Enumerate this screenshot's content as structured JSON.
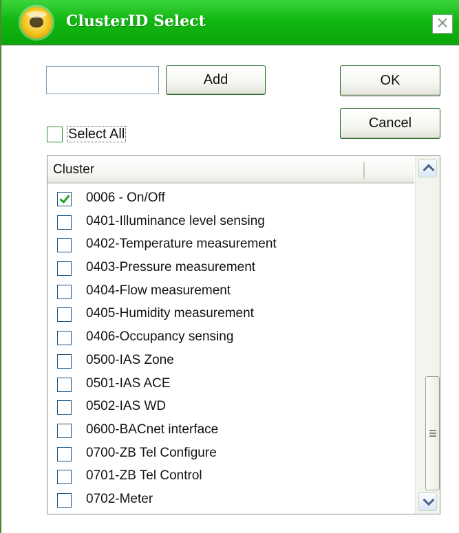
{
  "window": {
    "title": "ClusterID Select",
    "close_glyph": "×"
  },
  "form": {
    "input_value": "",
    "add_label": "Add",
    "ok_label": "OK",
    "cancel_label": "Cancel",
    "select_all_label": "Select All",
    "select_all_checked": false
  },
  "list": {
    "column_header": "Cluster",
    "items": [
      {
        "label": "0006 - On/Off",
        "checked": true
      },
      {
        "label": "0401-Illuminance level sensing",
        "checked": false
      },
      {
        "label": "0402-Temperature measurement",
        "checked": false
      },
      {
        "label": "0403-Pressure measurement",
        "checked": false
      },
      {
        "label": "0404-Flow measurement",
        "checked": false
      },
      {
        "label": "0405-Humidity measurement",
        "checked": false
      },
      {
        "label": "0406-Occupancy sensing",
        "checked": false
      },
      {
        "label": "0500-IAS Zone",
        "checked": false
      },
      {
        "label": "0501-IAS ACE",
        "checked": false
      },
      {
        "label": "0502-IAS WD",
        "checked": false
      },
      {
        "label": "0600-BACnet interface",
        "checked": false
      },
      {
        "label": "0700-ZB Tel Configure",
        "checked": false
      },
      {
        "label": "0701-ZB Tel Control",
        "checked": false
      },
      {
        "label": "0702-Meter",
        "checked": false
      }
    ]
  },
  "icons": {
    "title_icon": "bee-app-icon",
    "close": "close-icon",
    "scroll_up": "chevron-up-icon",
    "scroll_down": "chevron-down-icon"
  },
  "colors": {
    "titlebar": "#12b812",
    "button_border": "#1e6a1e",
    "checkmark": "#21a121"
  }
}
